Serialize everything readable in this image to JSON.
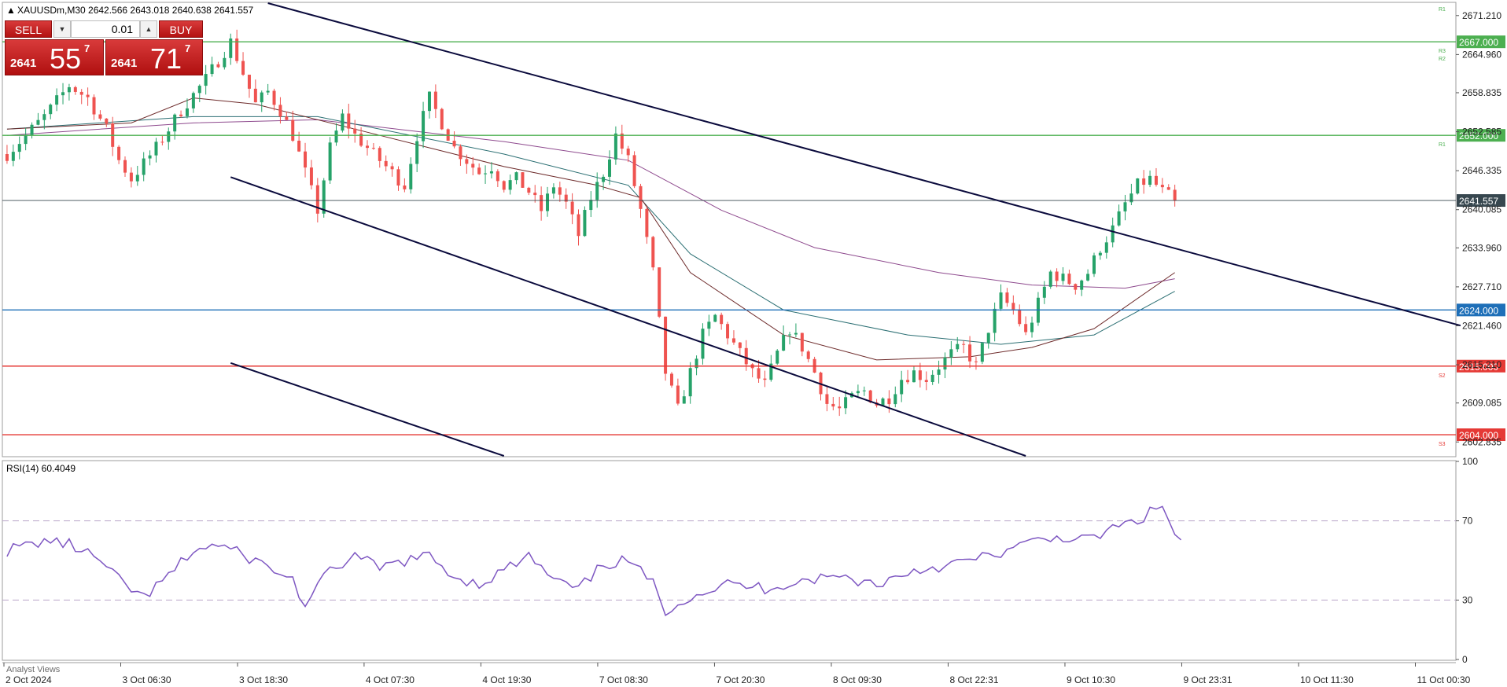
{
  "header": {
    "symbol_line": "XAUUSDm,M30  2642.566 2643.018 2640.638 2641.557"
  },
  "trade_panel": {
    "sell_label": "SELL",
    "buy_label": "BUY",
    "lot_value": "0.01",
    "sell_price": {
      "small": "2641",
      "big": "55",
      "sup": "7"
    },
    "buy_price": {
      "small": "2641",
      "big": "71",
      "sup": "7"
    }
  },
  "indicator": {
    "label": "RSI(14) 60.4049"
  },
  "bottom_tab": "Analyst Views",
  "colors": {
    "up_candle": "#26a269",
    "down_candle": "#ef5350",
    "channel_line": "#0a0a3c",
    "resistance": "#4caf50",
    "support": "#e53935",
    "pivot": "#1e6fb8",
    "current_price": "#37474f",
    "rsi_line": "#7e57c2",
    "ma_purple": "#8e4a8e",
    "ma_teal": "#2b6f73",
    "ma_brown": "#6d2a2a"
  },
  "chart_data": [
    {
      "type": "candlestick",
      "symbol": "XAUUSDm",
      "timeframe": "M30",
      "ohlc_current": {
        "open": 2642.566,
        "high": 2643.018,
        "low": 2640.638,
        "close": 2641.557
      },
      "ylim": [
        2600.6,
        2673.2
      ],
      "y_ticks": [
        "2671.210",
        "2664.960",
        "2658.835",
        "2652.585",
        "2646.335",
        "2640.085",
        "2633.960",
        "2627.710",
        "2621.460",
        "2615.210",
        "2609.085",
        "2602.835"
      ],
      "x_ticks": [
        "2 Oct 2024",
        "3 Oct 06:30",
        "3 Oct 18:30",
        "4 Oct 07:30",
        "4 Oct 19:30",
        "7 Oct 08:30",
        "7 Oct 20:30",
        "8 Oct 09:30",
        "8 Oct 22:31",
        "9 Oct 10:30",
        "9 Oct 23:31",
        "10 Oct 11:30",
        "11 Oct 00:30"
      ],
      "price_path": [
        [
          0,
          2649
        ],
        [
          6,
          2655
        ],
        [
          10,
          2660
        ],
        [
          13,
          2658
        ],
        [
          16,
          2653
        ],
        [
          18,
          2648
        ],
        [
          20,
          2645
        ],
        [
          24,
          2650
        ],
        [
          28,
          2656
        ],
        [
          32,
          2661
        ],
        [
          34,
          2664
        ],
        [
          36,
          2667
        ],
        [
          38,
          2662
        ],
        [
          40,
          2657
        ],
        [
          42,
          2659
        ],
        [
          44,
          2656
        ],
        [
          46,
          2652
        ],
        [
          48,
          2646
        ],
        [
          50,
          2640
        ],
        [
          52,
          2650
        ],
        [
          54,
          2655
        ],
        [
          56,
          2652
        ],
        [
          58,
          2650
        ],
        [
          60,
          2648
        ],
        [
          62,
          2646
        ],
        [
          64,
          2644
        ],
        [
          66,
          2652
        ],
        [
          68,
          2658
        ],
        [
          70,
          2654
        ],
        [
          72,
          2650
        ],
        [
          74,
          2648
        ],
        [
          76,
          2646
        ],
        [
          78,
          2647
        ],
        [
          80,
          2644
        ],
        [
          82,
          2645
        ],
        [
          84,
          2643
        ],
        [
          86,
          2640
        ],
        [
          88,
          2644
        ],
        [
          90,
          2641
        ],
        [
          92,
          2636
        ],
        [
          94,
          2642
        ],
        [
          96,
          2646
        ],
        [
          98,
          2652
        ],
        [
          100,
          2648
        ],
        [
          102,
          2640
        ],
        [
          104,
          2630
        ],
        [
          106,
          2614
        ],
        [
          108,
          2608
        ],
        [
          110,
          2614
        ],
        [
          112,
          2620
        ],
        [
          114,
          2623
        ],
        [
          116,
          2620
        ],
        [
          118,
          2617
        ],
        [
          120,
          2614
        ],
        [
          122,
          2612
        ],
        [
          124,
          2617
        ],
        [
          126,
          2621
        ],
        [
          128,
          2618
        ],
        [
          130,
          2614
        ],
        [
          132,
          2609
        ],
        [
          134,
          2608
        ],
        [
          136,
          2610
        ],
        [
          138,
          2611
        ],
        [
          140,
          2609
        ],
        [
          142,
          2610
        ],
        [
          144,
          2613
        ],
        [
          146,
          2614
        ],
        [
          148,
          2613
        ],
        [
          150,
          2615
        ],
        [
          152,
          2617
        ],
        [
          154,
          2618
        ],
        [
          156,
          2615
        ],
        [
          158,
          2621
        ],
        [
          160,
          2626
        ],
        [
          162,
          2624
        ],
        [
          164,
          2620
        ],
        [
          166,
          2625
        ],
        [
          168,
          2630
        ],
        [
          170,
          2629
        ],
        [
          172,
          2628
        ],
        [
          174,
          2630
        ],
        [
          176,
          2634
        ],
        [
          178,
          2637
        ],
        [
          180,
          2641
        ],
        [
          182,
          2644
        ],
        [
          184,
          2645
        ],
        [
          186,
          2643
        ],
        [
          188,
          2641.557
        ]
      ],
      "bars_total": 234,
      "moving_averages": [
        {
          "color": "ma_purple",
          "points": [
            [
              0,
              2652
            ],
            [
              30,
              2654
            ],
            [
              50,
              2654.5
            ],
            [
              80,
              2651
            ],
            [
              100,
              2648
            ],
            [
              115,
              2640
            ],
            [
              130,
              2634
            ],
            [
              150,
              2630
            ],
            [
              165,
              2628
            ],
            [
              180,
              2627.5
            ],
            [
              188,
              2629
            ]
          ]
        },
        {
          "color": "ma_teal",
          "points": [
            [
              0,
              2653
            ],
            [
              30,
              2655
            ],
            [
              50,
              2655
            ],
            [
              80,
              2649
            ],
            [
              100,
              2644
            ],
            [
              110,
              2633
            ],
            [
              125,
              2624
            ],
            [
              145,
              2620
            ],
            [
              160,
              2618.5
            ],
            [
              175,
              2620
            ],
            [
              188,
              2627
            ]
          ]
        },
        {
          "color": "ma_brown",
          "points": [
            [
              0,
              2653
            ],
            [
              20,
              2654
            ],
            [
              30,
              2658
            ],
            [
              40,
              2657
            ],
            [
              60,
              2652
            ],
            [
              80,
              2647
            ],
            [
              95,
              2644
            ],
            [
              102,
              2642
            ],
            [
              110,
              2630
            ],
            [
              125,
              2620
            ],
            [
              140,
              2616
            ],
            [
              155,
              2616.5
            ],
            [
              165,
              2618
            ],
            [
              175,
              2621
            ],
            [
              188,
              2630
            ]
          ]
        }
      ],
      "horizontal_levels": [
        {
          "label": "2667.000",
          "value": 2667.0,
          "color": "resistance",
          "tag": "R3"
        },
        {
          "label": "2652.000",
          "value": 2652.0,
          "color": "resistance",
          "tag": "R1"
        },
        {
          "label": "2641.557",
          "value": 2641.557,
          "color": "current_price",
          "tag": ""
        },
        {
          "label": "2624.000",
          "value": 2624.0,
          "color": "pivot",
          "tag": ""
        },
        {
          "label": "2615.000",
          "value": 2615.0,
          "color": "support",
          "tag": "S2"
        },
        {
          "label": "2604.000",
          "value": 2604.0,
          "color": "support",
          "tag": "S3"
        }
      ],
      "r2_tag": "R2",
      "r1_top_tag": "R1",
      "channel_lines": [
        {
          "from": [
            42,
            2673.2
          ],
          "to": [
            234,
            2621.5
          ]
        },
        {
          "from": [
            36,
            2645.3
          ],
          "to": [
            164,
            2600.6
          ]
        },
        {
          "from": [
            36,
            2615.5
          ],
          "to": [
            80,
            2600.6
          ]
        }
      ]
    },
    {
      "type": "line",
      "name": "RSI(14)",
      "ylim": [
        0,
        100
      ],
      "y_ticks": [
        "100",
        "70",
        "30",
        "0"
      ],
      "levels": [
        70,
        30
      ],
      "values": [
        [
          0,
          55
        ],
        [
          6,
          60
        ],
        [
          10,
          58
        ],
        [
          14,
          52
        ],
        [
          18,
          40
        ],
        [
          22,
          31
        ],
        [
          26,
          42
        ],
        [
          30,
          55
        ],
        [
          34,
          58
        ],
        [
          40,
          50
        ],
        [
          46,
          40
        ],
        [
          48,
          27
        ],
        [
          52,
          45
        ],
        [
          56,
          52
        ],
        [
          60,
          46
        ],
        [
          64,
          50
        ],
        [
          68,
          52
        ],
        [
          72,
          42
        ],
        [
          76,
          38
        ],
        [
          80,
          45
        ],
        [
          84,
          52
        ],
        [
          88,
          40
        ],
        [
          92,
          35
        ],
        [
          96,
          48
        ],
        [
          100,
          50
        ],
        [
          104,
          38
        ],
        [
          106,
          25
        ],
        [
          110,
          32
        ],
        [
          116,
          38
        ],
        [
          122,
          36
        ],
        [
          128,
          40
        ],
        [
          134,
          42
        ],
        [
          140,
          38
        ],
        [
          146,
          45
        ],
        [
          152,
          48
        ],
        [
          158,
          52
        ],
        [
          162,
          56
        ],
        [
          166,
          60
        ],
        [
          170,
          62
        ],
        [
          174,
          60
        ],
        [
          178,
          66
        ],
        [
          182,
          70
        ],
        [
          186,
          78
        ],
        [
          188,
          62
        ],
        [
          189,
          60.4
        ]
      ]
    }
  ]
}
